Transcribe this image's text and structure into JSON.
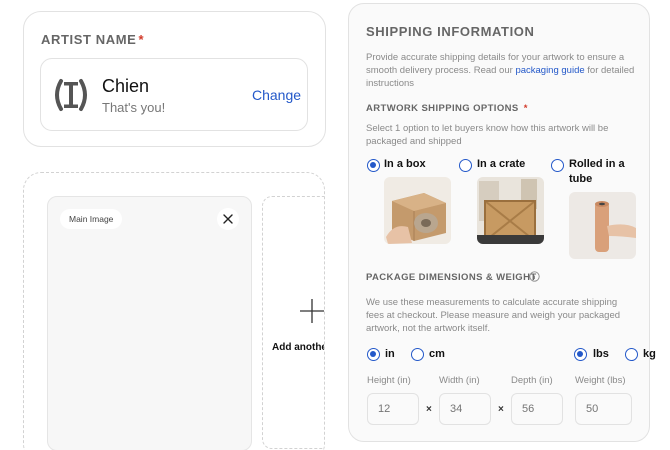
{
  "artist": {
    "title": "ARTIST NAME",
    "required_mark": "*",
    "name": "Chien",
    "subtitle": "That's you!",
    "change_label": "Change"
  },
  "upload": {
    "main_image_label": "Main Image",
    "add_another_label": "Add another"
  },
  "shipping": {
    "title": "SHIPPING INFORMATION",
    "intro_prefix": "Provide accurate shipping details for your artwork to ensure a smooth delivery process. Read our ",
    "intro_link": "packaging guide",
    "intro_suffix": " for detailed instructions",
    "options_title": "ARTWORK SHIPPING OPTIONS",
    "options_required_mark": "*",
    "options_desc": "Select 1 option to let buyers know how this artwork will be packaged and shipped",
    "options": [
      {
        "label": "In a box",
        "selected": true,
        "icon": "box-photo"
      },
      {
        "label": "In a crate",
        "selected": false,
        "icon": "crate-photo"
      },
      {
        "label": "Rolled in a tube",
        "selected": false,
        "icon": "tube-photo"
      }
    ],
    "dims_title": "PACKAGE DIMENSIONS & WEIGHT",
    "dims_desc": "We use these measurements to calculate accurate shipping fees at checkout. Please measure and weigh your packaged artwork, not the artwork itself.",
    "units": [
      {
        "label": "in",
        "selected": true
      },
      {
        "label": "cm",
        "selected": false
      },
      {
        "label": "lbs",
        "selected": true
      },
      {
        "label": "kg",
        "selected": false
      }
    ],
    "fields": [
      {
        "label": "Height (in)",
        "placeholder": "12"
      },
      {
        "label": "Width (in)",
        "placeholder": "34"
      },
      {
        "label": "Depth (in)",
        "placeholder": "56"
      },
      {
        "label": "Weight (lbs)",
        "placeholder": "50"
      }
    ],
    "times_symbol": "×"
  },
  "colors": {
    "accent": "#2358c9",
    "required": "#d23a2a"
  }
}
